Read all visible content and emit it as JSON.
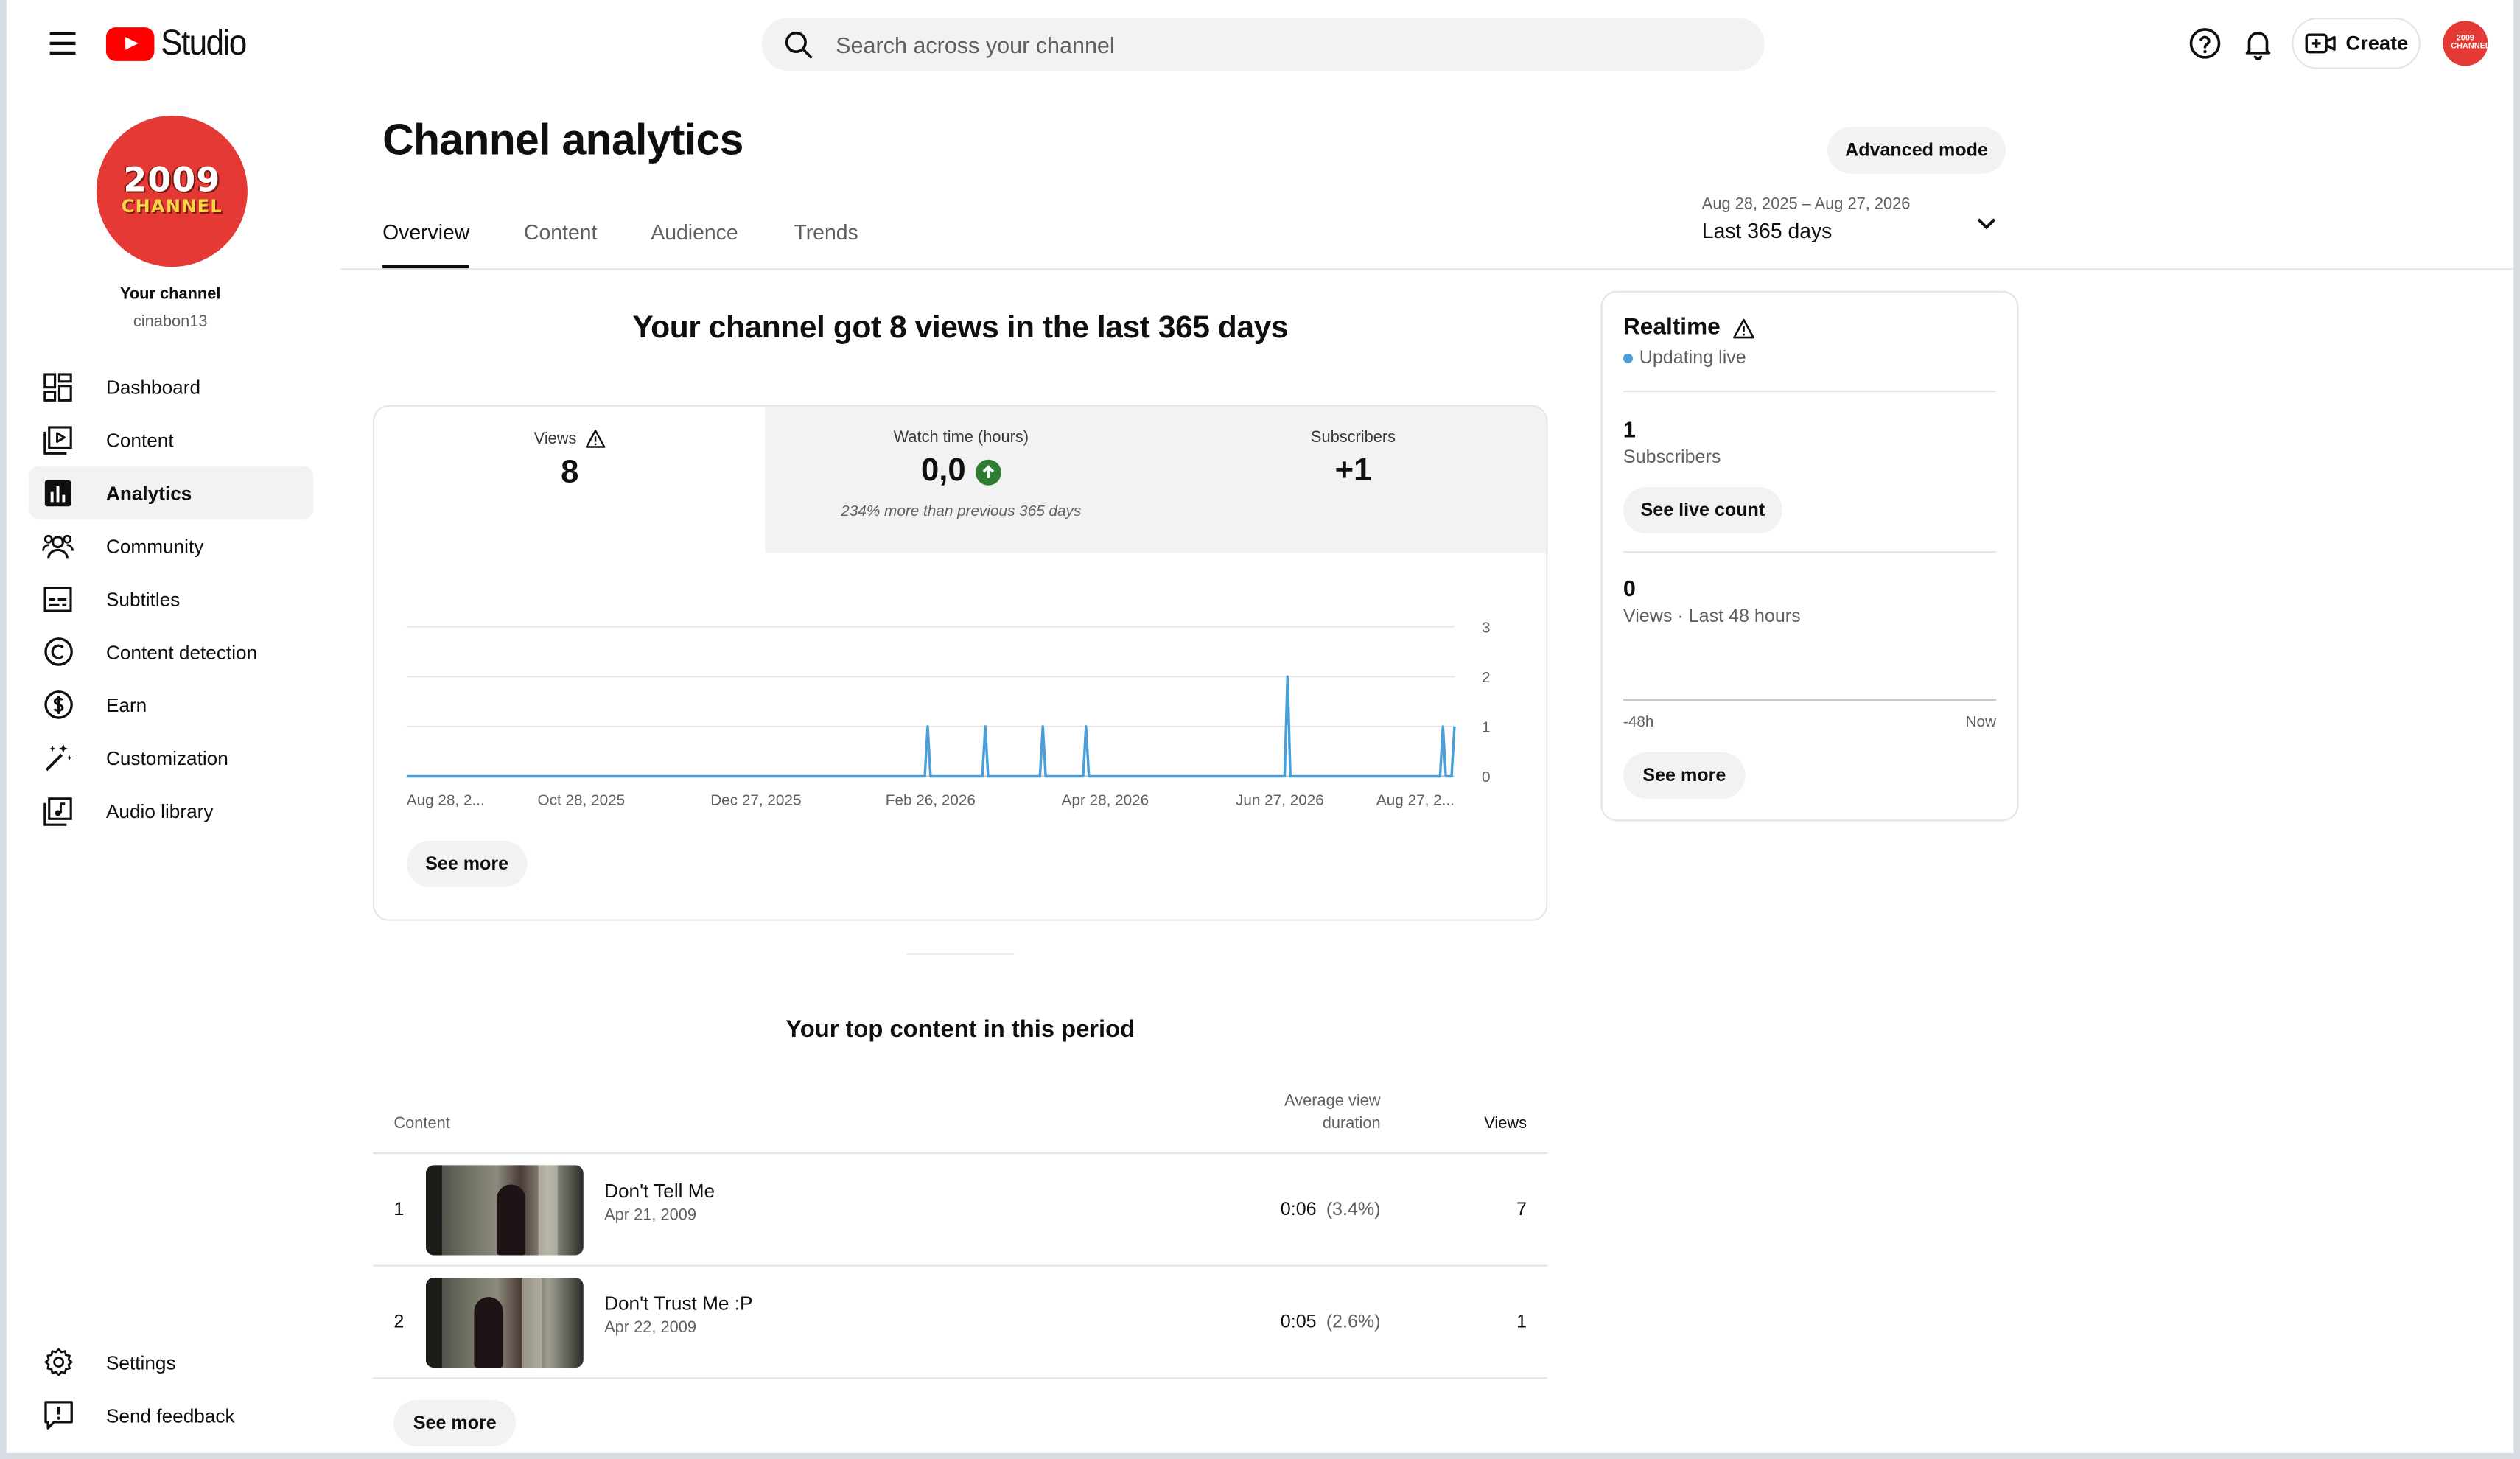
{
  "app": {
    "logo_text": "Studio",
    "search_placeholder": "Search across your channel",
    "create_label": "Create",
    "avatar_text": "2009 CHANNEL"
  },
  "sidebar": {
    "avatar_line1": "2009",
    "avatar_line2": "CHANNEL",
    "your_channel": "Your channel",
    "handle": "cinabon13",
    "items": [
      {
        "label": "Dashboard",
        "icon": "dashboard-icon"
      },
      {
        "label": "Content",
        "icon": "content-icon"
      },
      {
        "label": "Analytics",
        "icon": "analytics-icon",
        "active": true
      },
      {
        "label": "Community",
        "icon": "community-icon"
      },
      {
        "label": "Subtitles",
        "icon": "subtitles-icon"
      },
      {
        "label": "Content detection",
        "icon": "copyright-icon"
      },
      {
        "label": "Earn",
        "icon": "dollar-icon"
      },
      {
        "label": "Customization",
        "icon": "magic-wand-icon"
      },
      {
        "label": "Audio library",
        "icon": "audio-library-icon"
      }
    ],
    "bottom_items": [
      {
        "label": "Settings",
        "icon": "gear-icon"
      },
      {
        "label": "Send feedback",
        "icon": "feedback-icon"
      }
    ]
  },
  "header": {
    "title": "Channel analytics",
    "advanced_mode": "Advanced mode",
    "tabs": [
      "Overview",
      "Content",
      "Audience",
      "Trends"
    ],
    "active_tab": "Overview",
    "date_range": "Aug 28, 2025 – Aug 27, 2026",
    "date_label": "Last 365 days"
  },
  "overview": {
    "headline": "Your channel got 8 views in the last 365 days",
    "metrics": [
      {
        "label": "Views",
        "value": "8",
        "sub": ""
      },
      {
        "label": "Watch time (hours)",
        "value": "0,0",
        "sub": "234% more than previous 365 days"
      },
      {
        "label": "Subscribers",
        "value": "+1",
        "sub": ""
      }
    ],
    "see_more": "See more"
  },
  "chart_data": {
    "type": "line",
    "title": "",
    "xlabel": "",
    "ylabel": "",
    "ylim": [
      0,
      3
    ],
    "yticks": [
      "0",
      "1",
      "2",
      "3"
    ],
    "x_tick_labels": [
      "Aug 28, 2...",
      "Oct 28, 2025",
      "Dec 27, 2025",
      "Feb 26, 2026",
      "Apr 28, 2026",
      "Jun 27, 2026",
      "Aug 27, 2..."
    ],
    "x_start": "2025-08-28",
    "x_end": "2026-08-27",
    "grid": true,
    "series": [
      {
        "color": "#4a9fd8",
        "points": [
          {
            "date": "2026-02-25",
            "value": 1
          },
          {
            "date": "2026-03-17",
            "value": 1
          },
          {
            "date": "2026-04-06",
            "value": 1
          },
          {
            "date": "2026-04-21",
            "value": 1
          },
          {
            "date": "2026-06-30",
            "value": 2
          },
          {
            "date": "2026-08-23",
            "value": 1
          },
          {
            "date": "2026-08-27",
            "value": 1
          }
        ]
      }
    ]
  },
  "top_content": {
    "title": "Your top content in this period",
    "col_content": "Content",
    "col_avg_line1": "Average view",
    "col_avg_line2": "duration",
    "col_views": "Views",
    "rows": [
      {
        "rank": "1",
        "title": "Don't Tell Me",
        "date": "Apr 21, 2009",
        "duration": "0:06",
        "pct": "(3.4%)",
        "views": "7"
      },
      {
        "rank": "2",
        "title": "Don't Trust Me :P",
        "date": "Apr 22, 2009",
        "duration": "0:05",
        "pct": "(2.6%)",
        "views": "1"
      }
    ],
    "see_more": "See more"
  },
  "realtime": {
    "title": "Realtime",
    "live": "Updating live",
    "subs_value": "1",
    "subs_label": "Subscribers",
    "see_live_count": "See live count",
    "views_value": "0",
    "views_label": "Views · Last 48 hours",
    "axis_start": "-48h",
    "axis_end": "Now",
    "see_more": "See more"
  },
  "colors": {
    "accent": "#4a9fd8",
    "brand": "#ff0000",
    "positive": "#2e7d32"
  }
}
